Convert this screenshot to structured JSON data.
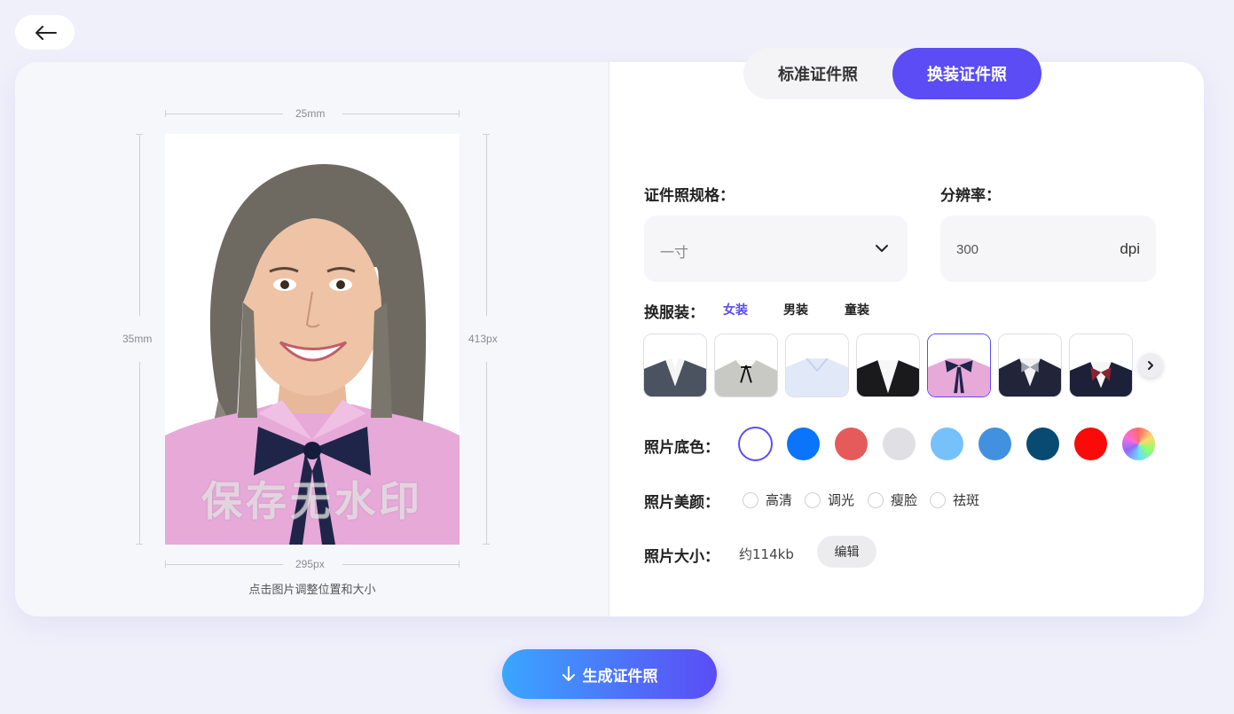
{
  "nav": {
    "back_icon": "arrow-left-icon"
  },
  "preview": {
    "width_mm": "25mm",
    "height_mm": "35mm",
    "height_px": "413px",
    "width_px": "295px",
    "watermark": "保存无水印",
    "hint": "点击图片调整位置和大小"
  },
  "tabs": [
    {
      "label": "标准证件照",
      "active": false
    },
    {
      "label": "换装证件照",
      "active": true
    }
  ],
  "spec": {
    "label": "证件照规格：",
    "value": "一寸",
    "icon": "chevron-down-icon"
  },
  "resolution": {
    "label": "分辨率：",
    "value": "300",
    "unit": "dpi"
  },
  "outfit": {
    "label": "换服装：",
    "categories": [
      {
        "label": "女装",
        "active": true
      },
      {
        "label": "男装",
        "active": false
      },
      {
        "label": "童装",
        "active": false
      }
    ],
    "selected_index": 4,
    "next_icon": "chevron-right-icon"
  },
  "bg_color": {
    "label": "照片底色：",
    "colors": [
      "#ffffff",
      "#0a74fa",
      "#e55b5b",
      "#e0dfe4",
      "#77c1fb",
      "#4290e0",
      "#094a72",
      "#fb0a0a",
      "rainbow"
    ],
    "selected_index": 0
  },
  "beauty": {
    "label": "照片美颜：",
    "options": [
      "高清",
      "调光",
      "瘦脸",
      "祛斑"
    ]
  },
  "size": {
    "label": "照片大小：",
    "value": "约114kb",
    "edit_label": "编辑"
  },
  "generate": {
    "label": "生成证件照",
    "icon": "download-arrow-icon"
  },
  "colors": {
    "accent": "#5b4cf5",
    "gradient_start": "#3aa6ff"
  }
}
